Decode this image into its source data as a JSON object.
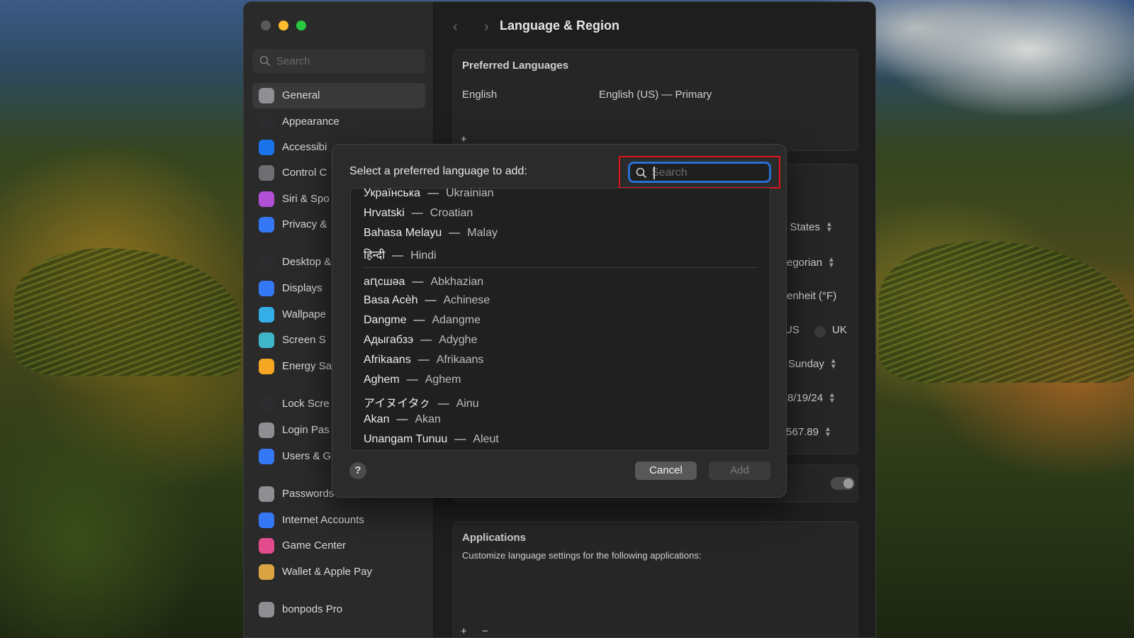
{
  "window": {
    "title": "Language & Region"
  },
  "sidebar": {
    "search_placeholder": "Search",
    "items": [
      {
        "label": "General",
        "icon": "gear-icon",
        "color": "#8e8e93",
        "active": true
      },
      {
        "label": "Appearance",
        "icon": "appearance-icon",
        "color": "#2c2c2e"
      },
      {
        "label": "Accessibi",
        "icon": "accessibility-icon",
        "color": "#1a73e8"
      },
      {
        "label": "Control C",
        "icon": "control-center-icon",
        "color": "#6e6e73"
      },
      {
        "label": "Siri & Spo",
        "icon": "siri-icon",
        "color": "#b14fd6"
      },
      {
        "label": "Privacy &",
        "icon": "privacy-hand-icon",
        "color": "#3478f6"
      },
      {
        "label": "Desktop &",
        "icon": "desktop-dock-icon",
        "color": "#2c2c2e"
      },
      {
        "label": "Displays",
        "icon": "displays-icon",
        "color": "#3478f6"
      },
      {
        "label": "Wallpape",
        "icon": "wallpaper-icon",
        "color": "#35aee8"
      },
      {
        "label": "Screen S",
        "icon": "screen-saver-icon",
        "color": "#3fb5c9"
      },
      {
        "label": "Energy Sa",
        "icon": "energy-icon",
        "color": "#f5a623"
      },
      {
        "label": "Lock Scre",
        "icon": "lock-icon",
        "color": "#2c2c2e"
      },
      {
        "label": "Login Pas",
        "icon": "login-password-icon",
        "color": "#8e8e93"
      },
      {
        "label": "Users & G",
        "icon": "users-icon",
        "color": "#3478f6"
      },
      {
        "label": "Passwords",
        "icon": "key-icon",
        "color": "#8e8e93"
      },
      {
        "label": "Internet Accounts",
        "icon": "at-sign-icon",
        "color": "#3478f6"
      },
      {
        "label": "Game Center",
        "icon": "game-center-icon",
        "color": "#e34c8c"
      },
      {
        "label": "Wallet & Apple Pay",
        "icon": "wallet-icon",
        "color": "#d9a441"
      },
      {
        "label": "bonpods Pro",
        "icon": "airpods-icon",
        "color": "#8e8e93"
      }
    ]
  },
  "content": {
    "preferred_languages": {
      "title": "Preferred Languages",
      "language": "English",
      "detail": "English (US) — Primary"
    },
    "background_values": {
      "region": "l States",
      "calendar": "regorian",
      "temperature": "renheit (°F)",
      "measure_us": "US",
      "measure_uk": "UK",
      "first_day": "Sunday",
      "date_format": "8/19/24",
      "number_format": ",567.89"
    },
    "applications": {
      "title": "Applications",
      "subtitle": "Customize language settings for the following applications:"
    }
  },
  "dialog": {
    "prompt": "Select a preferred language to add:",
    "search_placeholder": "Search",
    "languages": [
      {
        "native": "Українська",
        "english": "Ukrainian"
      },
      {
        "native": "Hrvatski",
        "english": "Croatian"
      },
      {
        "native": "Bahasa Melayu",
        "english": "Malay"
      },
      {
        "native": "हिन्दी",
        "english": "Hindi"
      },
      {
        "native": "аԥсшәа",
        "english": "Abkhazian"
      },
      {
        "native": "Basa Acèh",
        "english": "Achinese"
      },
      {
        "native": "Dangme",
        "english": "Adangme"
      },
      {
        "native": "Адыгабзэ",
        "english": "Adyghe"
      },
      {
        "native": "Afrikaans",
        "english": "Afrikaans"
      },
      {
        "native": "Aghem",
        "english": "Aghem"
      },
      {
        "native": "アイヌイタㇰ",
        "english": "Ainu"
      },
      {
        "native": "Akan",
        "english": "Akan"
      },
      {
        "native": "Unangam Tunuu",
        "english": "Aleut"
      }
    ],
    "separator": "—",
    "help_label": "?",
    "cancel_label": "Cancel",
    "add_label": "Add"
  },
  "colors": {
    "accent": "#2a6ed4",
    "highlight_box": "#e0131b"
  }
}
